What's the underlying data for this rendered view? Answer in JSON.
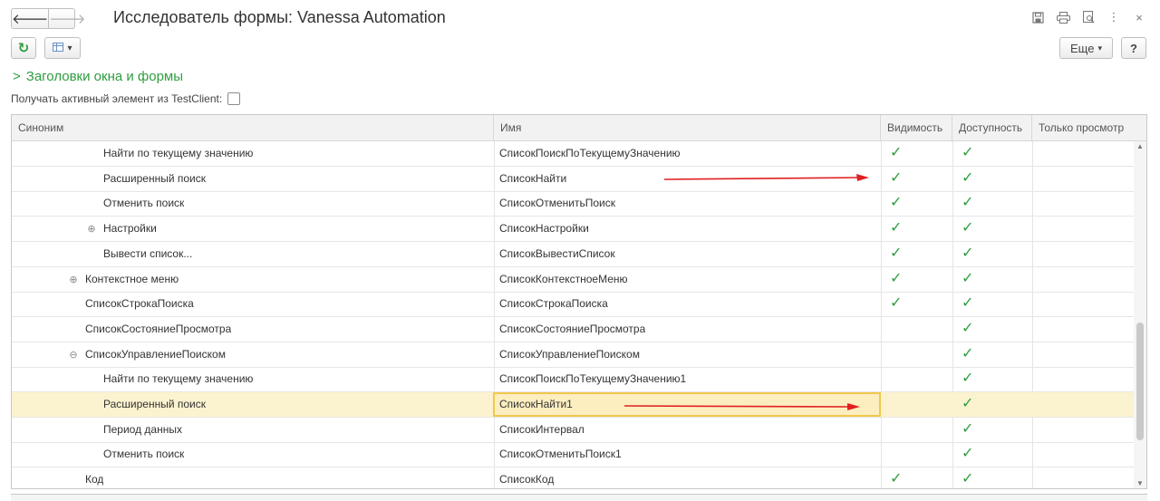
{
  "window": {
    "title": "Исследователь формы: Vanessa Automation",
    "icons": [
      "save-icon",
      "print-icon",
      "preview-icon",
      "more-vertical-icon",
      "close-icon"
    ]
  },
  "toolbar": {
    "more_label": "Еще",
    "help_label": "?"
  },
  "group": {
    "title": "Заголовки окна и формы",
    "expanded": false
  },
  "options": {
    "get_active_label": "Получать активный элемент из TestClient:",
    "get_active_checked": false
  },
  "table": {
    "columns": [
      "Синоним",
      "Имя",
      "Видимость",
      "Доступность",
      "Только просмотр"
    ],
    "rows": [
      {
        "synonym": "Найти по текущему значению",
        "name": "СписокПоискПоТекущемуЗначению",
        "level": 2,
        "expander": "",
        "visible": true,
        "available": true
      },
      {
        "synonym": "Расширенный поиск",
        "name": "СписокНайти",
        "level": 2,
        "expander": "",
        "visible": true,
        "available": true
      },
      {
        "synonym": "Отменить поиск",
        "name": "СписокОтменитьПоиск",
        "level": 2,
        "expander": "",
        "visible": true,
        "available": true
      },
      {
        "synonym": "Настройки",
        "name": "СписокНастройки",
        "level": 2,
        "expander": "⊕",
        "visible": true,
        "available": true
      },
      {
        "synonym": "Вывести список...",
        "name": "СписокВывестиСписок",
        "level": 2,
        "expander": "",
        "visible": true,
        "available": true
      },
      {
        "synonym": "Контекстное меню",
        "name": "СписокКонтекстноеМеню",
        "level": 1,
        "expander": "⊕",
        "visible": true,
        "available": true
      },
      {
        "synonym": "СписокСтрокаПоиска",
        "name": "СписокСтрокаПоиска",
        "level": 1,
        "expander": "",
        "visible": true,
        "available": true
      },
      {
        "synonym": "СписокСостояниеПросмотра",
        "name": "СписокСостояниеПросмотра",
        "level": 1,
        "expander": "",
        "visible": false,
        "available": true
      },
      {
        "synonym": "СписокУправлениеПоиском",
        "name": "СписокУправлениеПоиском",
        "level": 1,
        "expander": "⊖",
        "visible": false,
        "available": true
      },
      {
        "synonym": "Найти по текущему значению",
        "name": "СписокПоискПоТекущемуЗначению1",
        "level": 2,
        "expander": "",
        "visible": false,
        "available": true
      },
      {
        "synonym": "Расширенный поиск",
        "name": "СписокНайти1",
        "level": 2,
        "expander": "",
        "visible": false,
        "available": true,
        "selected": true
      },
      {
        "synonym": "Период данных",
        "name": "СписокИнтервал",
        "level": 2,
        "expander": "",
        "visible": false,
        "available": true
      },
      {
        "synonym": "Отменить поиск",
        "name": "СписокОтменитьПоиск1",
        "level": 2,
        "expander": "",
        "visible": false,
        "available": true
      },
      {
        "synonym": "Код",
        "name": "СписокКод",
        "level": 1,
        "expander": "",
        "visible": true,
        "available": true
      }
    ]
  }
}
